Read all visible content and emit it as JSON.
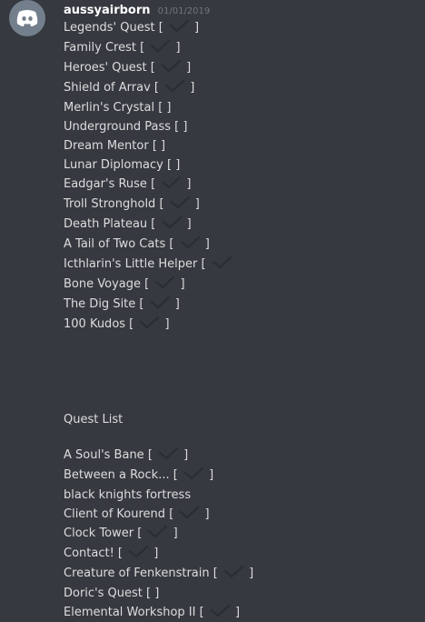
{
  "message": {
    "username": "aussyairborn",
    "timestamp": "01/01/2019"
  },
  "block1": [
    {
      "name": "Legends' Quest",
      "checked": true
    },
    {
      "name": "Family Crest",
      "checked": true
    },
    {
      "name": "Heroes' Quest",
      "checked": true
    },
    {
      "name": "Shield of Arrav",
      "checked": true
    },
    {
      "name": "Merlin's Crystal",
      "checked": false
    },
    {
      "name": "Underground Pass",
      "checked": false
    },
    {
      "name": "Dream Mentor",
      "checked": false
    },
    {
      "name": "Lunar Diplomacy",
      "checked": false
    },
    {
      "name": "Eadgar's Ruse",
      "checked": true
    },
    {
      "name": "Troll Stronghold",
      "checked": true
    },
    {
      "name": "Death Plateau",
      "checked": true
    },
    {
      "name": "A Tail of Two Cats",
      "checked": true
    },
    {
      "name": "Icthlarin's Little Helper",
      "checked": true,
      "open": true
    },
    {
      "name": "Bone Voyage",
      "checked": true
    },
    {
      "name": "The Dig Site",
      "checked": true
    },
    {
      "name": "100 Kudos",
      "checked": true
    }
  ],
  "quest_list_heading": "Quest List",
  "block2": [
    {
      "name": "A Soul's Bane",
      "checked": true
    },
    {
      "name": "Between a Rock...",
      "checked": true
    },
    {
      "name": "black knights fortress",
      "plain": true
    },
    {
      "name": "Client of Kourend",
      "checked": true
    },
    {
      "name": "Clock Tower",
      "checked": true
    },
    {
      "name": "Contact!",
      "checked": true
    },
    {
      "name": "Creature of Fenkenstrain",
      "checked": true
    },
    {
      "name": "Doric's Quest",
      "checked": false
    },
    {
      "name": "Elemental Workshop II",
      "checked": true
    }
  ],
  "icons": {
    "avatar": "discord-logo-icon",
    "check": "checkmark-icon"
  },
  "colors": {
    "background": "#36393f",
    "avatar": "#747f8d",
    "text": "#dcddde",
    "username": "#ffffff",
    "timestamp": "#72767d",
    "check": "#2b2e33"
  }
}
